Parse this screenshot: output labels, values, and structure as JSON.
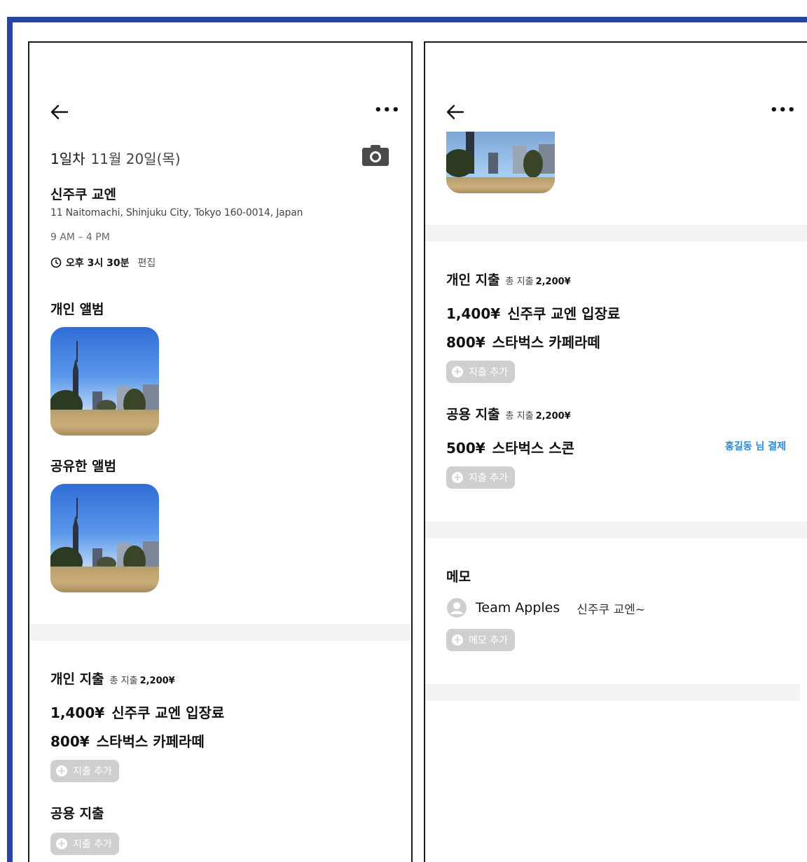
{
  "left": {
    "day_label": "1일차",
    "date": "11월 20일(목)",
    "place": {
      "name": "신주쿠 교엔",
      "address": "11 Naitomachi, Shinjuku City, Tokyo 160-0014, Japan",
      "hours": "9 AM – 4 PM",
      "time": "오후 3시 30분",
      "edit_label": "편집"
    },
    "personal_album_title": "개인 앨범",
    "shared_album_title": "공유한 앨범",
    "personal_expense": {
      "title": "개인 지출",
      "total_label": "총 지출",
      "total": "2,200¥",
      "items": [
        {
          "amount": "1,400¥",
          "label": "신주쿠 교엔 입장료"
        },
        {
          "amount": "800¥",
          "label": "스타벅스 카페라떼"
        }
      ],
      "add_label": "지출 추가"
    },
    "shared_expense": {
      "title": "공용 지출",
      "add_label": "지출 추가"
    }
  },
  "right": {
    "personal_expense": {
      "title": "개인 지출",
      "total_label": "총 지출",
      "total": "2,200¥",
      "items": [
        {
          "amount": "1,400¥",
          "label": "신주쿠 교엔 입장료"
        },
        {
          "amount": "800¥",
          "label": "스타벅스 카페라떼"
        }
      ],
      "add_label": "지출 추가"
    },
    "shared_expense": {
      "title": "공용 지출",
      "total_label": "총 지출",
      "total": "2,200¥",
      "items": [
        {
          "amount": "500¥",
          "label": "스타벅스 스콘",
          "payer": "홍길동 님 결제"
        }
      ],
      "add_label": "지출 추가"
    },
    "memo": {
      "title": "메모",
      "author": "Team Apples",
      "text": "신주쿠 교엔~",
      "add_label": "메모 추가"
    }
  },
  "colors": {
    "frame_border": "#2745a0",
    "chip_bg": "#cfcfcf",
    "payer_link": "#2a8ad8",
    "divider": "#f3f3f3"
  },
  "icons": [
    "back-arrow-icon",
    "more-icon",
    "camera-icon",
    "clock-icon",
    "plus-circle-icon",
    "avatar-icon"
  ]
}
